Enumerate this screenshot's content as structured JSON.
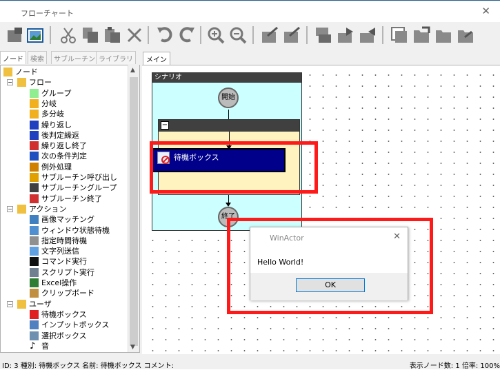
{
  "window": {
    "title": "フローチャート",
    "close_glyph": "✕"
  },
  "left_tabs": [
    "ノード",
    "検索",
    "サブルーチン",
    "ライブラリ"
  ],
  "tree": [
    {
      "label": "ノード",
      "level": 0,
      "icon": "folder-icon"
    },
    {
      "label": "フロー",
      "level": 1,
      "icon": "folder-icon"
    },
    {
      "label": "グループ",
      "level": 2,
      "icon": "group-icon"
    },
    {
      "label": "分岐",
      "level": 2,
      "icon": "branch-icon"
    },
    {
      "label": "多分岐",
      "level": 2,
      "icon": "multi-branch-icon"
    },
    {
      "label": "繰り返し",
      "level": 2,
      "icon": "loop-icon"
    },
    {
      "label": "後判定繰返",
      "level": 2,
      "icon": "post-loop-icon"
    },
    {
      "label": "繰り返し終了",
      "level": 2,
      "icon": "loop-end-icon"
    },
    {
      "label": "次の条件判定",
      "level": 2,
      "icon": "next-condition-icon"
    },
    {
      "label": "例外処理",
      "level": 2,
      "icon": "exception-icon"
    },
    {
      "label": "サブルーチン呼び出し",
      "level": 2,
      "icon": "subroutine-call-icon"
    },
    {
      "label": "サブルーチングループ",
      "level": 2,
      "icon": "subroutine-group-icon"
    },
    {
      "label": "サブルーチン終了",
      "level": 2,
      "icon": "subroutine-end-icon"
    },
    {
      "label": "アクション",
      "level": 1,
      "icon": "folder-icon"
    },
    {
      "label": "画像マッチング",
      "level": 2,
      "icon": "image-match-icon"
    },
    {
      "label": "ウィンドウ状態待機",
      "level": 2,
      "icon": "window-wait-icon"
    },
    {
      "label": "指定時間待機",
      "level": 2,
      "icon": "timer-icon"
    },
    {
      "label": "文字列送信",
      "level": 2,
      "icon": "keyboard-icon"
    },
    {
      "label": "コマンド実行",
      "level": 2,
      "icon": "command-icon"
    },
    {
      "label": "スクリプト実行",
      "level": 2,
      "icon": "script-icon"
    },
    {
      "label": "Excel操作",
      "level": 2,
      "icon": "excel-icon"
    },
    {
      "label": "クリップボード",
      "level": 2,
      "icon": "clipboard-icon"
    },
    {
      "label": "ユーザ",
      "level": 1,
      "icon": "folder-icon"
    },
    {
      "label": "待機ボックス",
      "level": 2,
      "icon": "wait-box-icon"
    },
    {
      "label": "インプットボックス",
      "level": 2,
      "icon": "input-box-icon"
    },
    {
      "label": "選択ボックス",
      "level": 2,
      "icon": "select-box-icon"
    },
    {
      "label": "音",
      "level": 2,
      "icon": "music-note-icon"
    }
  ],
  "main_tab": "メイン",
  "flow": {
    "scenario_label": "シナリオ",
    "start_label": "開始",
    "end_label": "終了",
    "group_collapse": "−",
    "wait_box_label": "待機ボックス"
  },
  "dialog": {
    "title": "WinActor",
    "message": "Hello World!",
    "ok": "OK",
    "close": "✕"
  },
  "status": {
    "left": "ID: 3  種別: 待機ボックス  名前: 待機ボックス  コメント:",
    "right": "表示ノード数: 1   倍率: 100%"
  },
  "colors": {
    "highlight": "#ff1a1a",
    "scenario_bg": "#ccffff",
    "node_bg": "#00008b",
    "group_band": "#fff4c0"
  }
}
